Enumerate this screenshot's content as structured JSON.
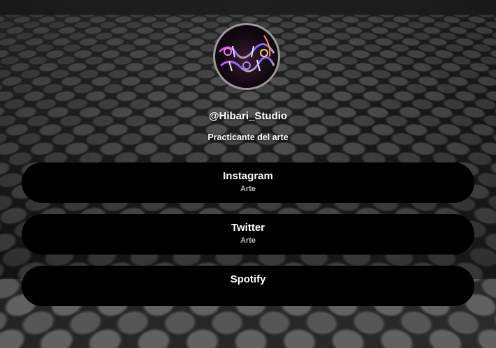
{
  "profile": {
    "handle": "@Hibari_Studio",
    "bio": "Practicante del arte",
    "avatar_icon": "hibari-studio-logo",
    "avatar_text": "HIBARI STUDIO"
  },
  "links": [
    {
      "title": "Instagram",
      "subtitle": "Arte"
    },
    {
      "title": "Twitter",
      "subtitle": "Arte"
    },
    {
      "title": "Spotify",
      "subtitle": ""
    }
  ],
  "colors": {
    "button_bg": "#000000",
    "text": "#ffffff",
    "subtitle": "#bbbbbb",
    "avatar_border": "#9a9a9a"
  }
}
